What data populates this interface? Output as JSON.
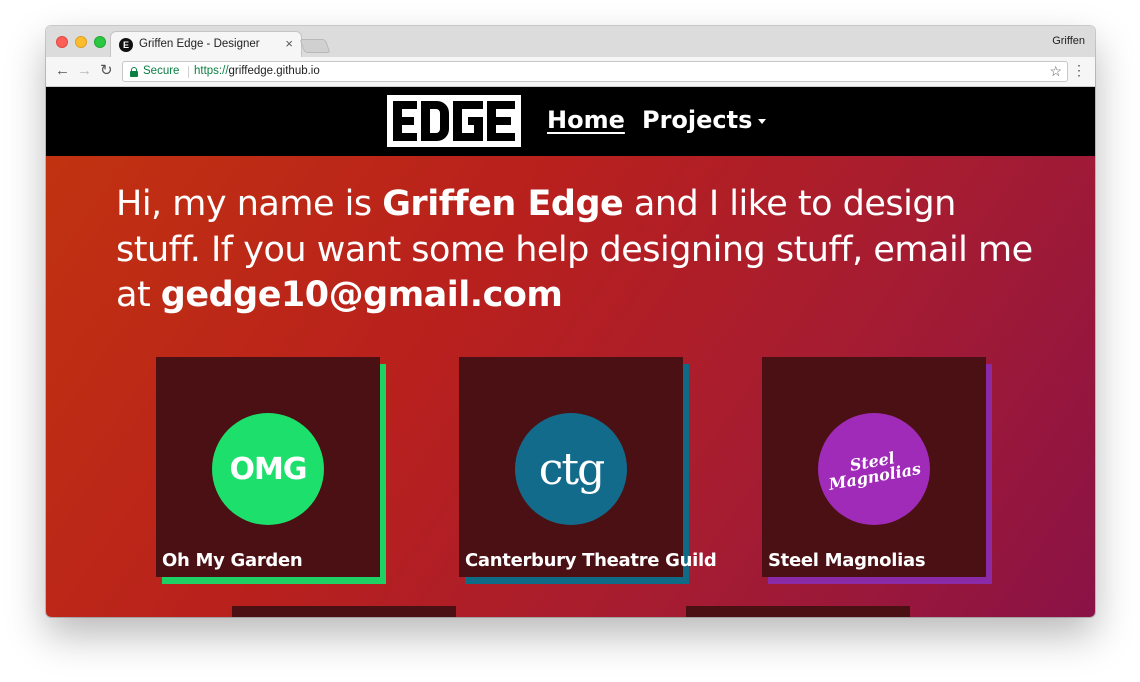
{
  "browser": {
    "tab_title": "Griffen Edge - Designer",
    "tab_favicon_letter": "E",
    "profile_name": "Griffen",
    "secure_label": "Secure",
    "url_scheme": "https://",
    "url_host": "griffedge.github.io"
  },
  "site": {
    "logo_text": "EDGE",
    "nav": {
      "home_label": "Home",
      "projects_label": "Projects"
    },
    "intro": {
      "part1": "Hi, my name is ",
      "name": "Griffen Edge",
      "part2": " and I like to design stuff. If you want some help designing stuff, email me at ",
      "email": "gedge10@gmail.com"
    },
    "projects": [
      {
        "title": "Oh My Garden",
        "logo_text": "OMG",
        "logo_color": "#1de06c",
        "accent_color": "#1fd064"
      },
      {
        "title": "Canterbury Theatre Guild",
        "logo_text": "ctg",
        "logo_color": "#136b8c",
        "accent_color": "#0f6a86"
      },
      {
        "title": "Steel Magnolias",
        "logo_text_line1": "Steel",
        "logo_text_line2": "Magnolias",
        "logo_color": "#a02bb8",
        "accent_color": "#8b2aa6"
      }
    ]
  }
}
